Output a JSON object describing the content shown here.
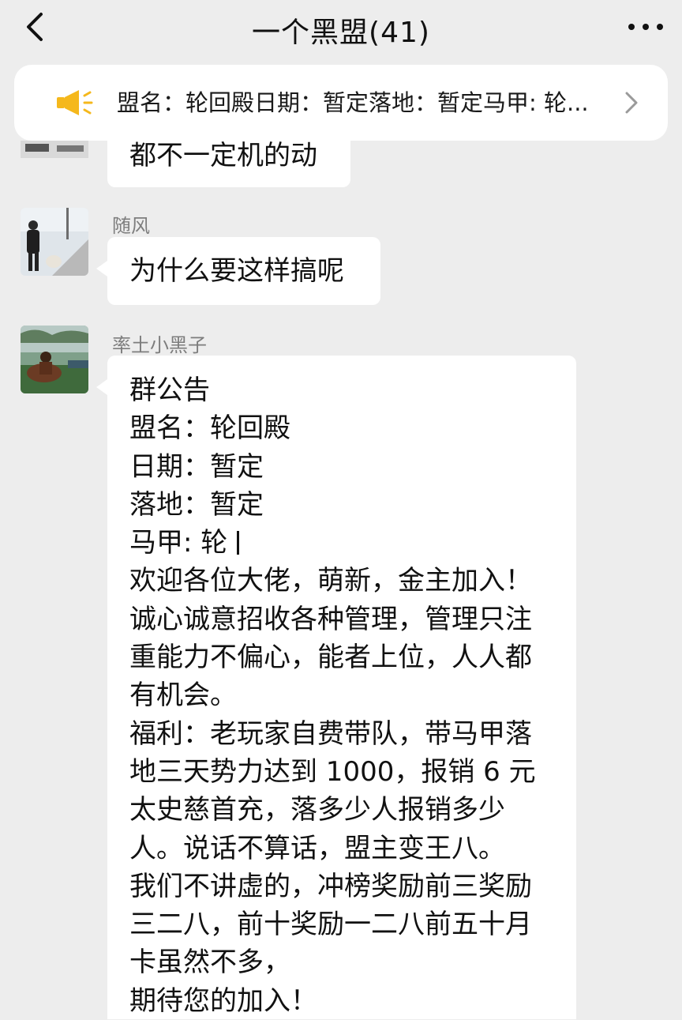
{
  "header": {
    "title": "一个黑盟(41)",
    "back_icon": "chevron-left-icon",
    "more_icon": "more-dots-icon"
  },
  "notice": {
    "icon": "megaphone-icon",
    "text": "盟名：轮回殿日期：暂定落地：暂定马甲: 轮...",
    "arrow_icon": "chevron-right-icon",
    "icon_color": "#f5b81c"
  },
  "messages": [
    {
      "partial": true,
      "text": "都不一定机的动"
    },
    {
      "sender": "随风",
      "text": "为什么要这样搞呢"
    },
    {
      "sender": "率土小黑子",
      "lines": [
        "群公告",
        "盟名：轮回殿",
        "日期：暂定",
        "落地：暂定",
        "马甲: 轮",
        "欢迎各位大佬，萌新，金主加入！",
        "诚心诚意招收各种管理，管理只注",
        "重能力不偏心，能者上位，人人都",
        "有机会。",
        "福利：老玩家自费带队，带马甲落",
        "地三天势力达到 1000，报销 6 元",
        "太史慈首充，落多少人报销多少",
        "人。说话不算话，盟主变王八。",
        "我们不讲虚的，冲榜奖励前三奖励",
        "三二八，前十奖励一二八前五十月",
        "卡虽然不多，",
        "期待您的加入！"
      ]
    }
  ]
}
